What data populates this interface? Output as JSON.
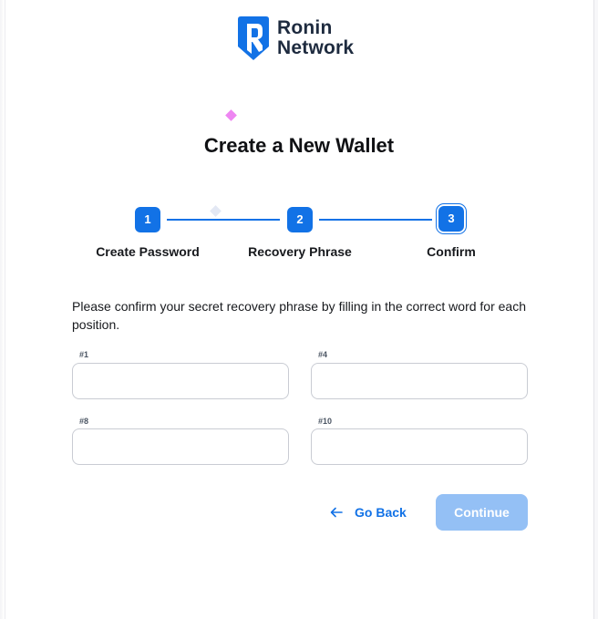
{
  "brand": {
    "line1": "Ronin",
    "line2": "Network",
    "color": "#1272e6"
  },
  "title": "Create a New Wallet",
  "steps": [
    {
      "number": "1",
      "label": "Create Password",
      "state": "completed"
    },
    {
      "number": "2",
      "label": "Recovery Phrase",
      "state": "completed"
    },
    {
      "number": "3",
      "label": "Confirm",
      "state": "current"
    }
  ],
  "instruction": "Please confirm your secret recovery phrase by filling in the correct word for each position.",
  "fields": [
    {
      "label": "#1",
      "value": ""
    },
    {
      "label": "#4",
      "value": ""
    },
    {
      "label": "#8",
      "value": ""
    },
    {
      "label": "#10",
      "value": ""
    }
  ],
  "actions": {
    "back_label": "Go Back",
    "continue_label": "Continue",
    "continue_enabled": false
  },
  "colors": {
    "accent": "#1272e6",
    "accent_disabled": "#94c0f5",
    "sparkle_pink": "#ee86f2"
  }
}
